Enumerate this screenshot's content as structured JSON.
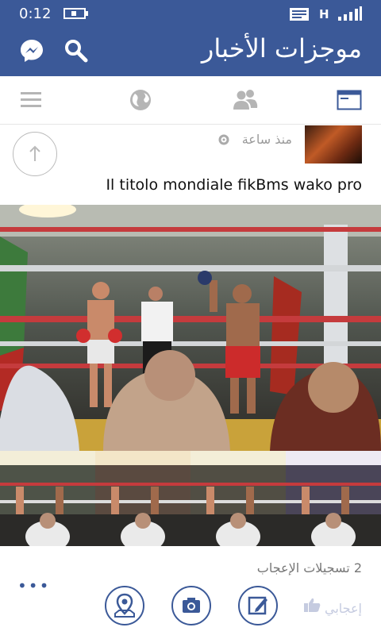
{
  "status": {
    "time": "0:12",
    "network": "H"
  },
  "header": {
    "title": "موجزات الأخبار"
  },
  "icons": {
    "messenger": "messenger-icon",
    "search": "search-icon",
    "menu": "menu-icon",
    "globe": "globe-icon",
    "friends": "friends-icon",
    "news": "news-feed-icon"
  },
  "post": {
    "time_ago": "منذ ساعة",
    "caption": "Il titolo mondiale fikBms wako pro",
    "likes": "2 تسجيلات الإعجاب",
    "like_label": "إعجابي"
  },
  "colors": {
    "brand": "#3b5998"
  }
}
